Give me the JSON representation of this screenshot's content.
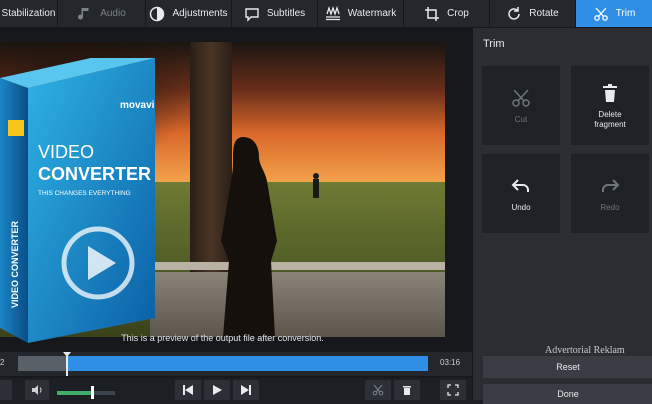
{
  "toolbar": {
    "stabilization": "Stabilization",
    "audio": "Audio",
    "adjustments": "Adjustments",
    "subtitles": "Subtitles",
    "watermark": "Watermark",
    "crop": "Crop",
    "rotate": "Rotate",
    "trim": "Trim"
  },
  "box": {
    "brand": "movavi",
    "title_line1": "VIDEO",
    "title_line2": "CONVERTER",
    "tagline": "THIS CHANGES EVERYTHING",
    "spine": "VIDEO CONVERTER"
  },
  "preview_note": "This is a preview of the output file after conversion.",
  "timeline": {
    "start": "2",
    "end": "03:16",
    "trim_start_fraction": 0.12
  },
  "volume": {
    "level": 0.6
  },
  "panel": {
    "title": "Trim",
    "cut": "Cut",
    "delete_line1": "Delete",
    "delete_line2": "fragment",
    "undo": "Undo",
    "redo": "Redo",
    "reset": "Reset",
    "done": "Done"
  },
  "watermark_text": "Advertorial Reklam",
  "colors": {
    "accent": "#2f8fe6",
    "volume": "#3fae6a",
    "panel": "#2a2d32"
  }
}
